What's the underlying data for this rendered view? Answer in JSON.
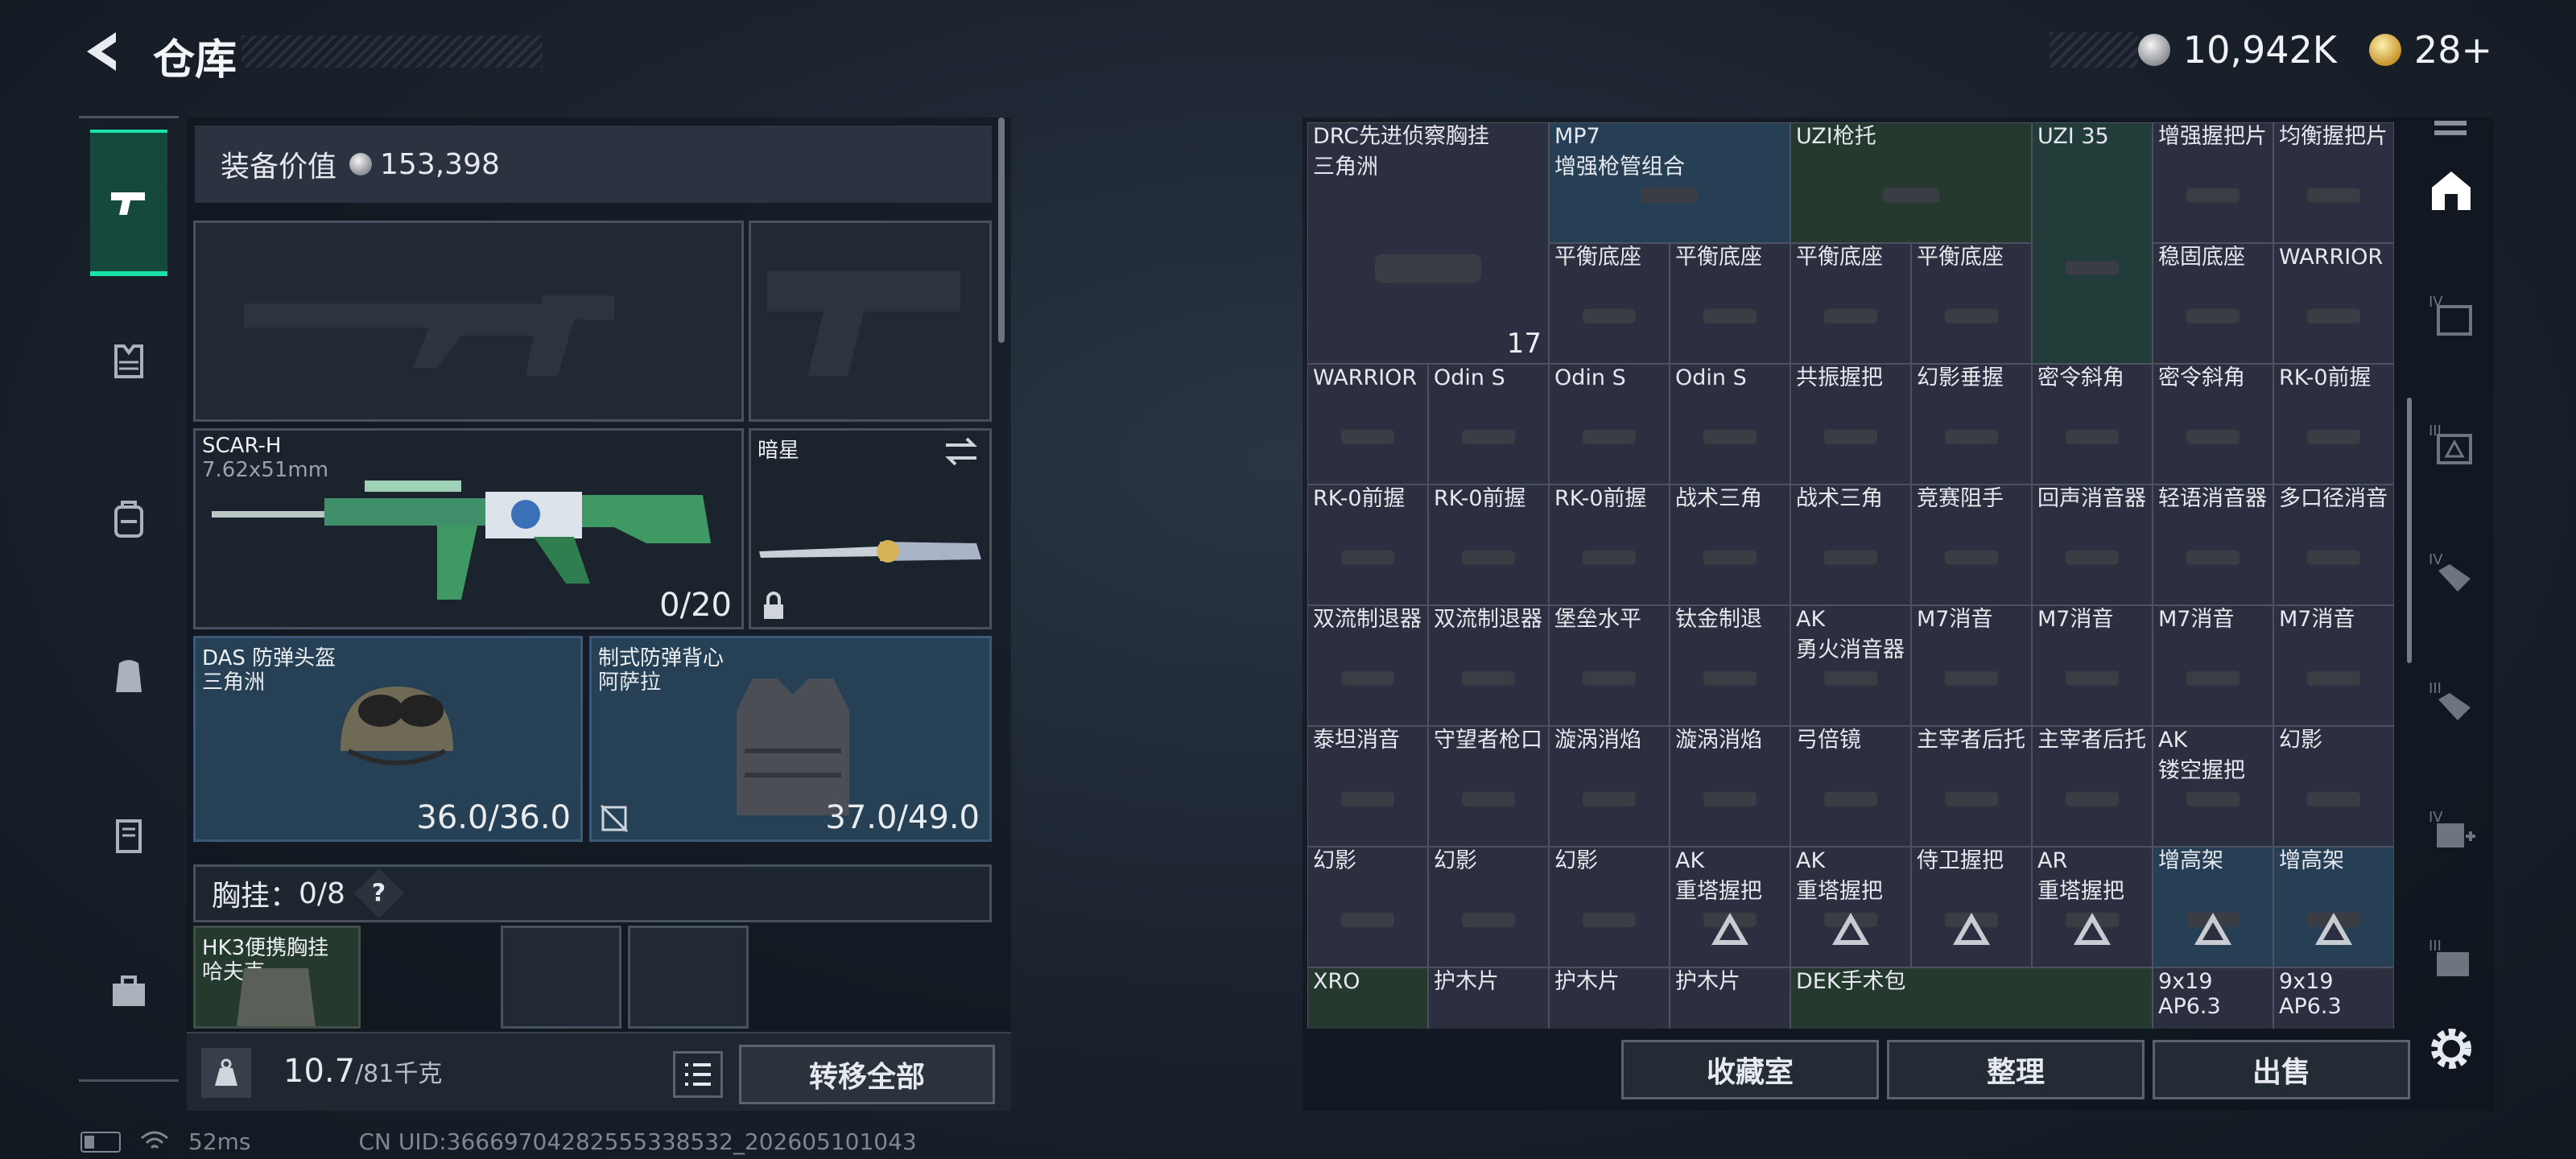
{
  "header": {
    "title": "仓库",
    "currency_silver": "10,942K",
    "currency_gold": "28+"
  },
  "nav": {
    "items": [
      "pistol-icon",
      "armor-icon",
      "backpack-icon",
      "rig-icon",
      "case-icon",
      "toolbox-icon"
    ],
    "active_index": 0
  },
  "equipment": {
    "value_label": "装备价值",
    "value": "153,398",
    "primary_weapon": {
      "name": "SCAR-H",
      "caliber": "7.62x51mm",
      "ammo": "0/20"
    },
    "melee": {
      "name": "暗星"
    },
    "helmet": {
      "name": "DAS 防弹头盔",
      "sub": "三角洲",
      "durability": "36.0/36.0"
    },
    "vest": {
      "name": "制式防弹背心",
      "sub": "阿萨拉",
      "durability": "37.0/49.0"
    },
    "chest_rig_label": "胸挂：",
    "chest_rig_count": "0/8",
    "chest_help": "?",
    "chest_rig_item": {
      "name": "HK3便携胸挂",
      "sub": "哈夫克"
    },
    "weight": "10.7",
    "weight_max": "/81千克",
    "transfer_all": "转移全部"
  },
  "status_bar": {
    "ping": "52ms",
    "uid": "CN UID:36669704282555338532_202605101043"
  },
  "storage": {
    "cells": [
      [
        "DRC先进侦察胸挂|三角洲",
        "MP7|增强枪管组合",
        "UZI枪托",
        "",
        "UZI 35",
        "增强握把片",
        "均衡握把片"
      ],
      [
        "",
        "平衡底座",
        "平衡底座",
        "平衡底座",
        "平衡底座",
        "",
        "稳固底座",
        "WARRIOR"
      ],
      [
        "WARRIOR",
        "Odin S",
        "Odin S",
        "Odin S",
        "共振握把",
        "幻影垂握",
        "密令斜角",
        "密令斜角",
        "RK-0前握"
      ],
      [
        "RK-0前握",
        "RK-0前握",
        "RK-0前握",
        "战术三角",
        "战术三角",
        "竞赛阻手",
        "回声消音器",
        "轻语消音器",
        "多口径消音"
      ],
      [
        "双流制退器",
        "双流制退器",
        "堡垒水平",
        "钛金制退",
        "AK|勇火消音器",
        "M7消音",
        "M7消音",
        "M7消音",
        "M7消音"
      ],
      [
        "泰坦消音",
        "守望者枪口",
        "漩涡消焰",
        "漩涡消焰",
        "弓倍镜",
        "主宰者后托",
        "主宰者后托",
        "AK|镂空握把",
        "幻影"
      ],
      [
        "幻影",
        "幻影",
        "幻影",
        "AK|重塔握把",
        "AK|重塔握把",
        "侍卫握把",
        "AR|重塔握把",
        "增高架",
        "增高架"
      ],
      [
        "XRO",
        "护木片",
        "护木片",
        "护木片",
        "DEK手术包",
        "",
        "",
        "9x19|AP6.3",
        "9x19|AP6.3"
      ]
    ],
    "backpack_count": "17",
    "buttons": {
      "collection": "收藏室",
      "organize": "整理",
      "sell": "出售"
    }
  },
  "right_rail": {
    "tabs": [
      "storage-icon",
      "tier-iv-icon",
      "tier-iii-icon",
      "tier-iv-med-icon",
      "tier-iii-med-icon",
      "tier-iv-plus-icon",
      "tier-iii-icon-2"
    ]
  }
}
